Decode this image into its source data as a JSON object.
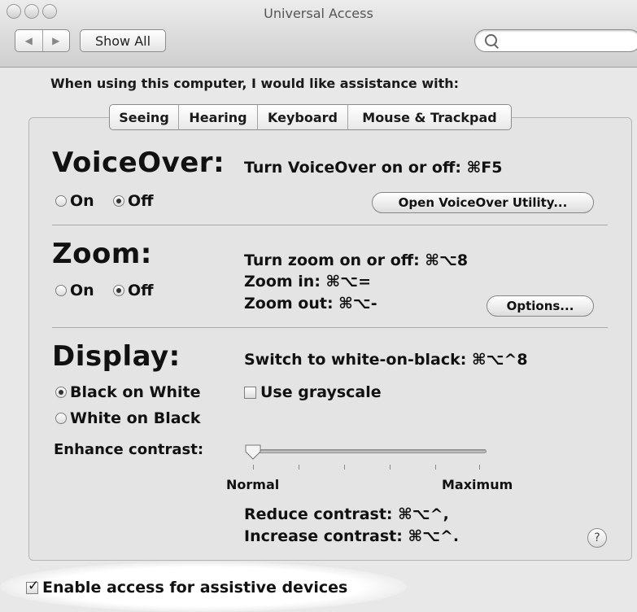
{
  "window": {
    "title": "Universal Access"
  },
  "toolbar": {
    "back": "◀",
    "forward": "▶",
    "show_all": "Show All",
    "search_placeholder": ""
  },
  "prompt": "When using this computer, I would like assistance with:",
  "tabs": [
    {
      "label": "Seeing",
      "selected": true
    },
    {
      "label": "Hearing",
      "selected": false
    },
    {
      "label": "Keyboard",
      "selected": false
    },
    {
      "label": "Mouse & Trackpad",
      "selected": false
    }
  ],
  "voiceover": {
    "title": "VoiceOver:",
    "shortcut": "Turn VoiceOver on or off: ⌘F5",
    "on_label": "On",
    "off_label": "Off",
    "selected": "Off",
    "utility_button": "Open VoiceOver Utility..."
  },
  "zoom": {
    "title": "Zoom:",
    "toggle_shortcut": "Turn zoom on or off: ⌘⌥8",
    "zoom_in": "Zoom in: ⌘⌥=",
    "zoom_out": "Zoom out: ⌘⌥-",
    "on_label": "On",
    "off_label": "Off",
    "selected": "Off",
    "options_button": "Options..."
  },
  "display": {
    "title": "Display:",
    "switch_shortcut": "Switch to white-on-black: ⌘⌥^8",
    "black_on_white": "Black on White",
    "white_on_black": "White on Black",
    "selected": "Black on White",
    "grayscale_label": "Use grayscale",
    "grayscale_checked": false,
    "contrast_label": "Enhance contrast:",
    "contrast_min": "Normal",
    "contrast_max": "Maximum",
    "contrast_value": 0,
    "reduce": "Reduce contrast: ⌘⌥^,",
    "increase": "Increase contrast: ⌘⌥^."
  },
  "help": "?",
  "assistive": {
    "label": "Enable access for assistive devices",
    "checked": true
  }
}
